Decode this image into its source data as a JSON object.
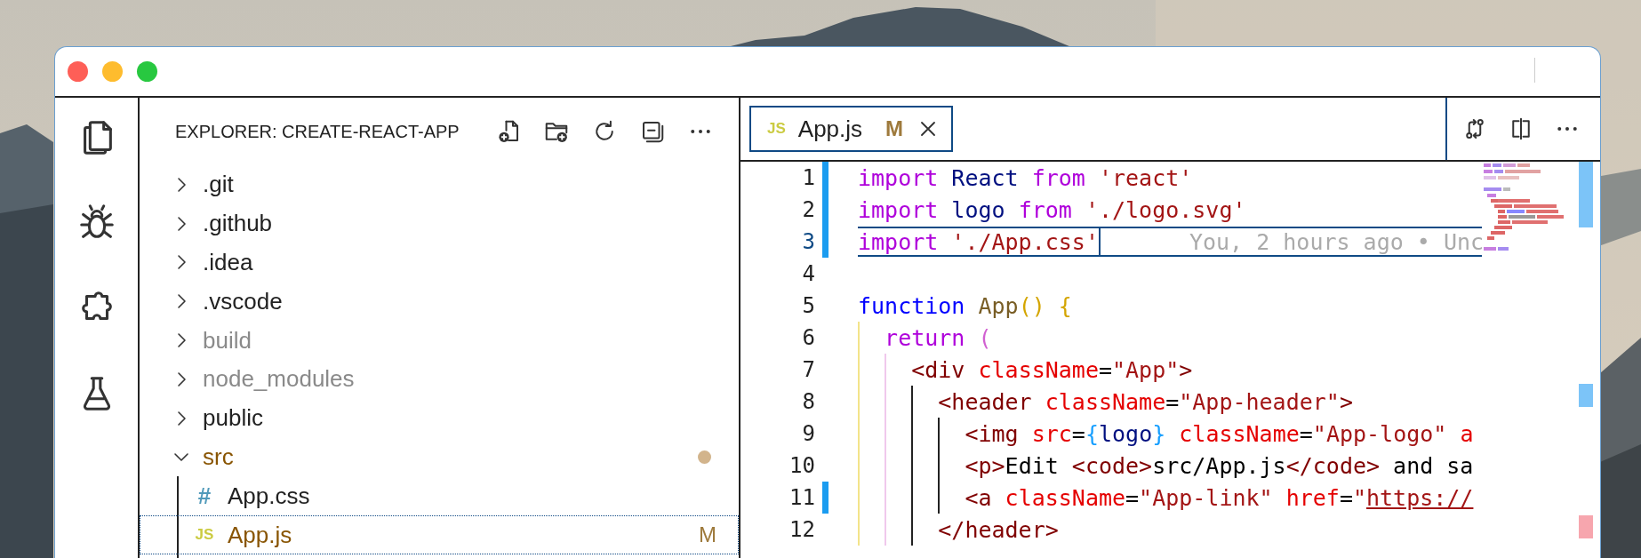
{
  "sidebar": {
    "title": "EXPLORER: CREATE-REACT-APP",
    "tree": [
      {
        "label": ".git",
        "kind": "folder",
        "expanded": false,
        "ignored": false,
        "modified": false,
        "selected": false
      },
      {
        "label": ".github",
        "kind": "folder",
        "expanded": false,
        "ignored": false,
        "modified": false,
        "selected": false
      },
      {
        "label": ".idea",
        "kind": "folder",
        "expanded": false,
        "ignored": false,
        "modified": false,
        "selected": false
      },
      {
        "label": ".vscode",
        "kind": "folder",
        "expanded": false,
        "ignored": false,
        "modified": false,
        "selected": false
      },
      {
        "label": "build",
        "kind": "folder",
        "expanded": false,
        "ignored": true,
        "modified": false,
        "selected": false
      },
      {
        "label": "node_modules",
        "kind": "folder",
        "expanded": false,
        "ignored": true,
        "modified": false,
        "selected": false
      },
      {
        "label": "public",
        "kind": "folder",
        "expanded": false,
        "ignored": false,
        "modified": false,
        "selected": false
      },
      {
        "label": "src",
        "kind": "folder",
        "expanded": true,
        "ignored": false,
        "modified": true,
        "selected": false,
        "children": [
          {
            "label": "App.css",
            "kind": "file",
            "color": "#519aba",
            "icon": "#",
            "ignored": false,
            "modified": false,
            "selected": false
          },
          {
            "label": "App.js",
            "kind": "file",
            "color": "#cbcb41",
            "icon": "JS",
            "ignored": false,
            "modified": true,
            "badge": "M",
            "selected": true
          }
        ]
      }
    ]
  },
  "editor": {
    "tabs": [
      {
        "label": "App.js",
        "color": "#cbcb41",
        "icon": "JS",
        "badge": "M",
        "modified": true,
        "selected": true
      }
    ],
    "lines": [
      {
        "number": "1",
        "changed": true,
        "current": false,
        "tokens": [
          {
            "kind": "keyword",
            "text": "import"
          },
          {
            "kind": "variable",
            "text": " React"
          },
          {
            "kind": "keyword",
            "text": " from"
          },
          {
            "kind": "string",
            "text": " 'react'"
          }
        ]
      },
      {
        "number": "2",
        "changed": true,
        "current": false,
        "tokens": [
          {
            "kind": "keyword",
            "text": "import"
          },
          {
            "kind": "variable",
            "text": " logo"
          },
          {
            "kind": "keyword",
            "text": " from"
          },
          {
            "kind": "string",
            "text": " './logo.svg'"
          }
        ]
      },
      {
        "number": "3",
        "changed": true,
        "current": true,
        "annotation": "You, 2 hours ago • Unc",
        "tokens": [
          {
            "kind": "keyword",
            "text": "import"
          },
          {
            "kind": "string",
            "text": " './App.css'"
          }
        ]
      },
      {
        "number": "4",
        "changed": false,
        "current": false
      },
      {
        "number": "5",
        "changed": false,
        "current": false,
        "tokens": [
          {
            "kind": "storage",
            "text": "function"
          },
          {
            "kind": "function",
            "text": " App"
          },
          {
            "kind": "bracket1",
            "text": "()"
          },
          {
            "kind": "bracket1",
            "text": " {"
          }
        ],
        "children": [
          {
            "number": "6",
            "changed": false,
            "current": false,
            "tokens": [
              {
                "kind": "keyword",
                "text": "return"
              },
              {
                "kind": "bracket2",
                "text": " ("
              }
            ],
            "children": [
              {
                "number": "7",
                "changed": false,
                "current": false,
                "tokens": [
                  {
                    "kind": "tag",
                    "text": "<div"
                  },
                  {
                    "kind": "attribute",
                    "text": " className"
                  },
                  {
                    "kind": "text",
                    "text": "="
                  },
                  {
                    "kind": "string",
                    "text": "\"App\""
                  },
                  {
                    "kind": "tag",
                    "text": ">"
                  }
                ],
                "children": [
                  {
                    "number": "8",
                    "changed": false,
                    "current": false,
                    "tokens": [
                      {
                        "kind": "tag",
                        "text": "<header"
                      },
                      {
                        "kind": "attribute",
                        "text": " className"
                      },
                      {
                        "kind": "text",
                        "text": "="
                      },
                      {
                        "kind": "string",
                        "text": "\"App-header\""
                      },
                      {
                        "kind": "tag",
                        "text": ">"
                      }
                    ],
                    "children": [
                      {
                        "number": "9",
                        "changed": false,
                        "current": false,
                        "tokens": [
                          {
                            "kind": "tag",
                            "text": "<img"
                          },
                          {
                            "kind": "attribute",
                            "text": " src"
                          },
                          {
                            "kind": "text",
                            "text": "="
                          },
                          {
                            "kind": "bracket3",
                            "text": "{"
                          },
                          {
                            "kind": "variable",
                            "text": "logo"
                          },
                          {
                            "kind": "bracket3",
                            "text": "}"
                          },
                          {
                            "kind": "attribute",
                            "text": " className"
                          },
                          {
                            "kind": "text",
                            "text": "="
                          },
                          {
                            "kind": "string",
                            "text": "\"App-logo\""
                          },
                          {
                            "kind": "attribute",
                            "text": " a"
                          }
                        ]
                      },
                      {
                        "number": "10",
                        "changed": false,
                        "current": false,
                        "tokens": [
                          {
                            "kind": "tag",
                            "text": "<p>"
                          },
                          {
                            "kind": "text",
                            "text": "Edit "
                          },
                          {
                            "kind": "tag",
                            "text": "<code>"
                          },
                          {
                            "kind": "text",
                            "text": "src/App.js"
                          },
                          {
                            "kind": "tag",
                            "text": "</code>"
                          },
                          {
                            "kind": "text",
                            "text": " and sa"
                          }
                        ]
                      },
                      {
                        "number": "11",
                        "changed": true,
                        "current": false,
                        "tokens": [
                          {
                            "kind": "tag",
                            "text": "<a"
                          },
                          {
                            "kind": "attribute",
                            "text": " className"
                          },
                          {
                            "kind": "text",
                            "text": "="
                          },
                          {
                            "kind": "string",
                            "text": "\"App-link\""
                          },
                          {
                            "kind": "attribute",
                            "text": " href"
                          },
                          {
                            "kind": "text",
                            "text": "="
                          },
                          {
                            "kind": "string",
                            "text": "\""
                          },
                          {
                            "kind": "link",
                            "text": "https://"
                          }
                        ]
                      }
                    ]
                  },
                  {
                    "number": "12",
                    "changed": false,
                    "current": false,
                    "tokens": [
                      {
                        "kind": "tag",
                        "text": "</header>"
                      }
                    ]
                  }
                ]
              }
            ]
          }
        ]
      }
    ]
  }
}
